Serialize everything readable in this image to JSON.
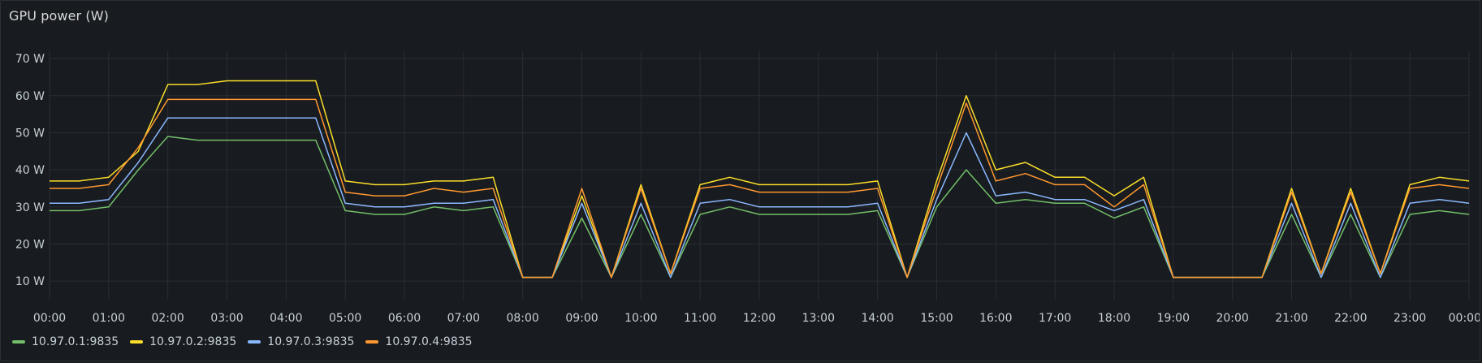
{
  "panel": {
    "title": "GPU power (W)"
  },
  "chart_data": {
    "type": "line",
    "title": "GPU power (W)",
    "xlabel": "",
    "ylabel": "",
    "y_unit": "W",
    "ylim": [
      5,
      72
    ],
    "xlim": [
      0,
      24
    ],
    "grid": true,
    "legend_position": "bottom-left",
    "y_ticks": [
      {
        "value": 10,
        "label": "10 W"
      },
      {
        "value": 20,
        "label": "20 W"
      },
      {
        "value": 30,
        "label": "30 W"
      },
      {
        "value": 40,
        "label": "40 W"
      },
      {
        "value": 50,
        "label": "50 W"
      },
      {
        "value": 60,
        "label": "60 W"
      },
      {
        "value": 70,
        "label": "70 W"
      }
    ],
    "x_ticks": [
      {
        "value": 0,
        "label": "00:00"
      },
      {
        "value": 1,
        "label": "01:00"
      },
      {
        "value": 2,
        "label": "02:00"
      },
      {
        "value": 3,
        "label": "03:00"
      },
      {
        "value": 4,
        "label": "04:00"
      },
      {
        "value": 5,
        "label": "05:00"
      },
      {
        "value": 6,
        "label": "06:00"
      },
      {
        "value": 7,
        "label": "07:00"
      },
      {
        "value": 8,
        "label": "08:00"
      },
      {
        "value": 9,
        "label": "09:00"
      },
      {
        "value": 10,
        "label": "10:00"
      },
      {
        "value": 11,
        "label": "11:00"
      },
      {
        "value": 12,
        "label": "12:00"
      },
      {
        "value": 13,
        "label": "13:00"
      },
      {
        "value": 14,
        "label": "14:00"
      },
      {
        "value": 15,
        "label": "15:00"
      },
      {
        "value": 16,
        "label": "16:00"
      },
      {
        "value": 17,
        "label": "17:00"
      },
      {
        "value": 18,
        "label": "18:00"
      },
      {
        "value": 19,
        "label": "19:00"
      },
      {
        "value": 20,
        "label": "20:00"
      },
      {
        "value": 21,
        "label": "21:00"
      },
      {
        "value": 22,
        "label": "22:00"
      },
      {
        "value": 23,
        "label": "23:00"
      },
      {
        "value": 24,
        "label": "00:00"
      }
    ],
    "x": [
      0,
      0.5,
      1,
      1.5,
      2,
      2.5,
      3,
      3.5,
      4,
      4.5,
      5,
      5.5,
      6,
      6.5,
      7,
      7.5,
      8,
      8.5,
      9,
      9.5,
      10,
      10.5,
      11,
      11.5,
      12,
      12.5,
      13,
      13.5,
      14,
      14.5,
      15,
      15.5,
      16,
      16.5,
      17,
      17.5,
      18,
      18.5,
      19,
      19.5,
      20,
      20.5,
      21,
      21.5,
      22,
      22.5,
      23,
      23.5,
      24
    ],
    "series": [
      {
        "name": "10.97.0.1:9835",
        "color": "#73bf69",
        "values": [
          29,
          29,
          30,
          40,
          49,
          48,
          48,
          48,
          48,
          48,
          29,
          28,
          28,
          30,
          29,
          30,
          11,
          11,
          27,
          11,
          28,
          11,
          28,
          30,
          28,
          28,
          28,
          28,
          29,
          11,
          30,
          40,
          31,
          32,
          31,
          31,
          27,
          30,
          11,
          11,
          11,
          11,
          28,
          11,
          28,
          11,
          28,
          29,
          28
        ]
      },
      {
        "name": "10.97.0.2:9835",
        "color": "#fade2a",
        "values": [
          37,
          37,
          38,
          45,
          63,
          63,
          64,
          64,
          64,
          64,
          37,
          36,
          36,
          37,
          37,
          38,
          11,
          11,
          33,
          11,
          36,
          12,
          36,
          38,
          36,
          36,
          36,
          36,
          37,
          11,
          37,
          60,
          40,
          42,
          38,
          38,
          33,
          38,
          11,
          11,
          11,
          11,
          35,
          12,
          35,
          12,
          36,
          38,
          37
        ]
      },
      {
        "name": "10.97.0.3:9835",
        "color": "#8ab8ff",
        "values": [
          31,
          31,
          32,
          42,
          54,
          54,
          54,
          54,
          54,
          54,
          31,
          30,
          30,
          31,
          31,
          32,
          11,
          11,
          31,
          11,
          31,
          11,
          31,
          32,
          30,
          30,
          30,
          30,
          31,
          11,
          32,
          50,
          33,
          34,
          32,
          32,
          29,
          32,
          11,
          11,
          11,
          11,
          31,
          11,
          31,
          11,
          31,
          32,
          31
        ]
      },
      {
        "name": "10.97.0.4:9835",
        "color": "#ff9830",
        "values": [
          35,
          35,
          36,
          46,
          59,
          59,
          59,
          59,
          59,
          59,
          34,
          33,
          33,
          35,
          34,
          35,
          11,
          11,
          35,
          11,
          35,
          12,
          35,
          36,
          34,
          34,
          34,
          34,
          35,
          11,
          35,
          58,
          37,
          39,
          36,
          36,
          30,
          36,
          11,
          11,
          11,
          11,
          34,
          12,
          34,
          12,
          35,
          36,
          35
        ]
      }
    ]
  }
}
